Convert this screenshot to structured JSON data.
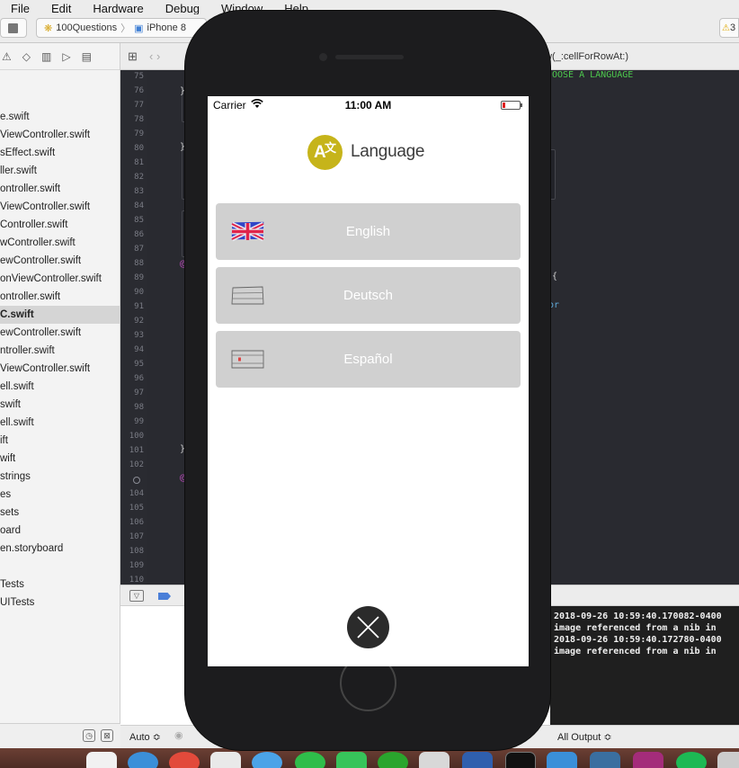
{
  "menubar": {
    "items": [
      "File",
      "Edit",
      "Hardware",
      "Debug",
      "Window",
      "Help"
    ]
  },
  "toolbar": {
    "scheme_project": "100Questions",
    "scheme_device": "iPhone 8",
    "warning_count": "3"
  },
  "jumpbar": {
    "breadcrumb": "ew(_:cellForRowAt:)"
  },
  "navigator": {
    "files": [
      "e.swift",
      "ViewController.swift",
      "sEffect.swift",
      "ller.swift",
      "ontroller.swift",
      "ViewController.swift",
      "Controller.swift",
      "wController.swift",
      "ewController.swift",
      "onViewController.swift",
      "ontroller.swift",
      "C.swift",
      "ewController.swift",
      "ntroller.swift",
      "ViewController.swift",
      "ell.swift",
      "swift",
      "ell.swift",
      "ift",
      "wift",
      "strings",
      "es",
      "sets",
      "oard",
      "en.storyboard"
    ],
    "selected_index": 11,
    "tests": [
      "Tests",
      "UITests"
    ]
  },
  "editor": {
    "line_numbers": [
      "75",
      "76",
      "77",
      "78",
      "79",
      "80",
      "81",
      "82",
      "83",
      "84",
      "85",
      "86",
      "87",
      "88",
      "89",
      "90",
      "91",
      "92",
      "93",
      "94",
      "95",
      "96",
      "97",
      "98",
      "99",
      "100",
      "101",
      "102",
      "",
      "104",
      "105",
      "106",
      "107",
      "108",
      "109",
      "110"
    ],
    "fragments": {
      "comment": "OOSE A LANGUAGE",
      "brace_76": "}",
      "brace_80": "}",
      "at_88": "@",
      "open_brace": "{",
      "keyword": "or",
      "brace_101": "}",
      "at_103": "@"
    }
  },
  "console": {
    "lines": [
      "2018-09-26 10:59:40.170082-0400",
      "image referenced from a nib in",
      "2018-09-26 10:59:40.172780-0400",
      "image referenced from a nib in"
    ]
  },
  "bottombar": {
    "auto_label": "Auto ≎",
    "output_label": "All Output ≎"
  },
  "simulator": {
    "status": {
      "carrier": "Carrier",
      "time": "11:00 AM",
      "battery_level": 0.15
    },
    "header": {
      "title": "Language",
      "logo_glyph_a": "A",
      "logo_glyph_b": "文"
    },
    "languages": [
      {
        "label": "English",
        "flag": "uk-flag-icon"
      },
      {
        "label": "Deutsch",
        "flag": "german-flag-icon"
      },
      {
        "label": "Español",
        "flag": "spanish-flag-icon"
      }
    ],
    "close_icon": "close-x-icon"
  },
  "colors": {
    "accent": "#c6b41a",
    "button_bg": "#d0d0d0",
    "editor_bg": "#292a30"
  }
}
